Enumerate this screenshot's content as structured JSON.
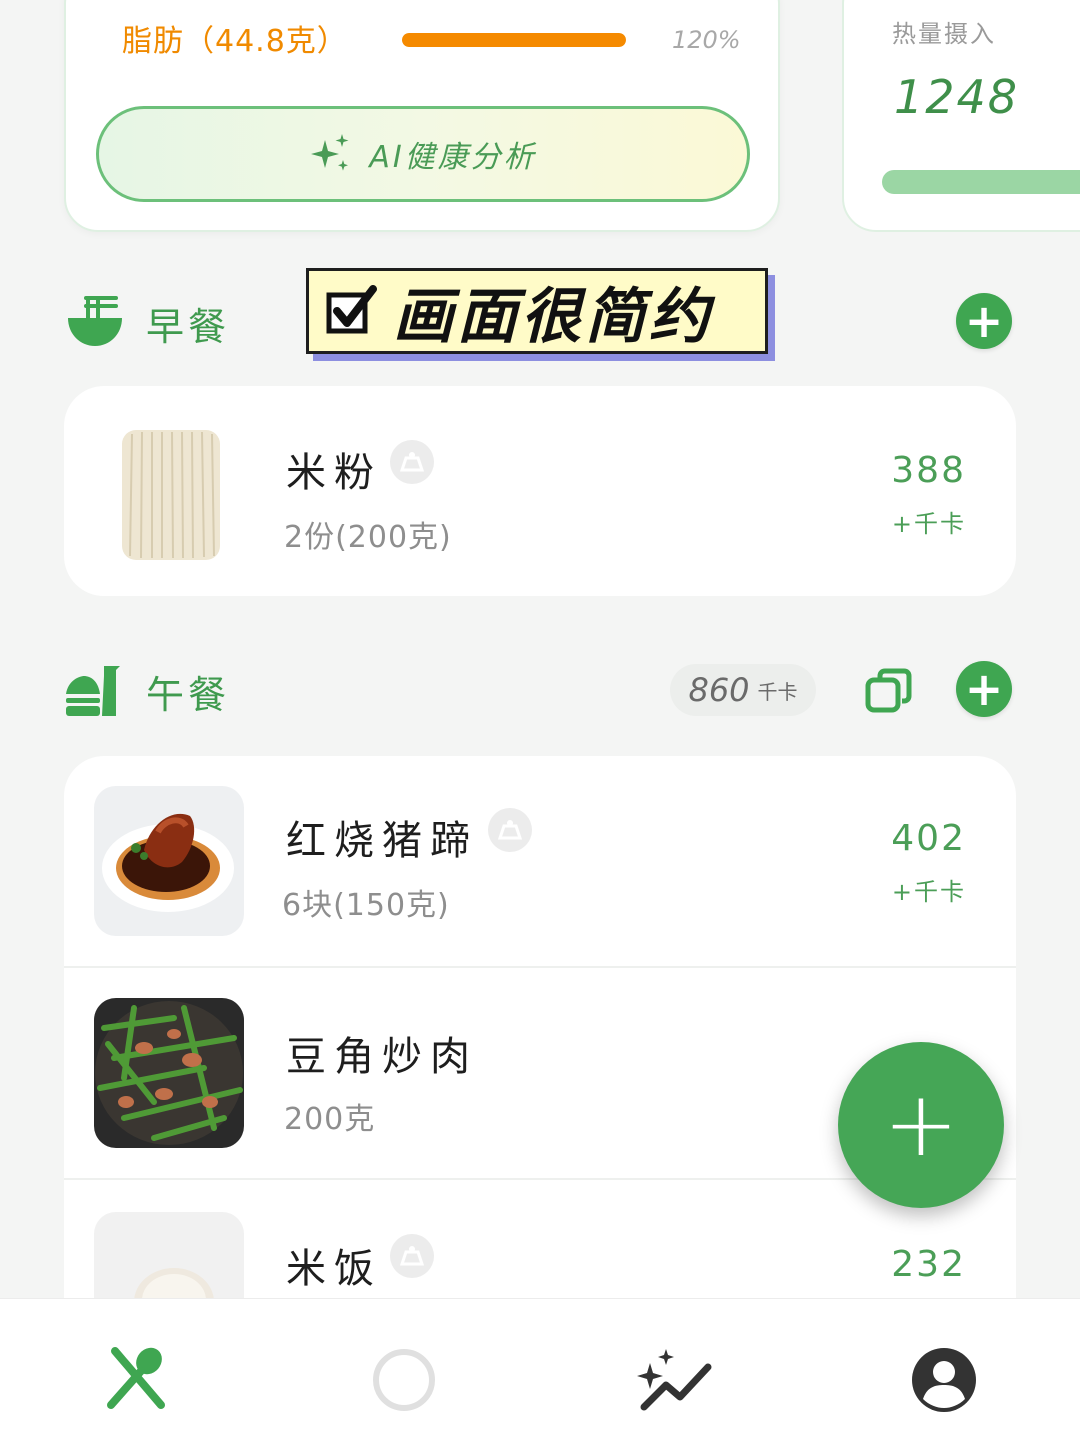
{
  "summary": {
    "fat_label": "脂肪（44.8克）",
    "fat_percent_text": "120%",
    "fat_progress_fraction": 1.0,
    "ai_button_label": "AI健康分析",
    "calorie_label": "热量摄入",
    "calorie_value": "1248",
    "calorie_progress_fraction": 1.0
  },
  "sticker": {
    "text": "画面很简约"
  },
  "breakfast": {
    "title": "早餐",
    "items": [
      {
        "name": "米粉",
        "portion": "2份(200克)",
        "kcal": "388",
        "unit": "+千卡"
      }
    ]
  },
  "lunch": {
    "title": "午餐",
    "total_kcal": "860",
    "total_unit": "千卡",
    "items": [
      {
        "name": "红烧猪蹄",
        "portion": "6块(150克)",
        "kcal": "402",
        "unit": "+千卡"
      },
      {
        "name": "豆角炒肉",
        "portion": "200克",
        "kcal": "",
        "unit": ""
      },
      {
        "name": "米饭",
        "portion": "",
        "kcal": "232",
        "unit": ""
      }
    ]
  },
  "fab": {
    "label": "+"
  },
  "colors": {
    "accent_green": "#45a656",
    "fat_orange": "#f58a00",
    "sticker_yellow": "#fffbc8",
    "sticker_shadow": "#8d8fe0"
  },
  "nav": {
    "items": [
      {
        "icon": "fork-spoon-icon"
      },
      {
        "icon": "circle-icon"
      },
      {
        "icon": "sparkle-chart-icon"
      },
      {
        "icon": "account-icon"
      }
    ]
  }
}
